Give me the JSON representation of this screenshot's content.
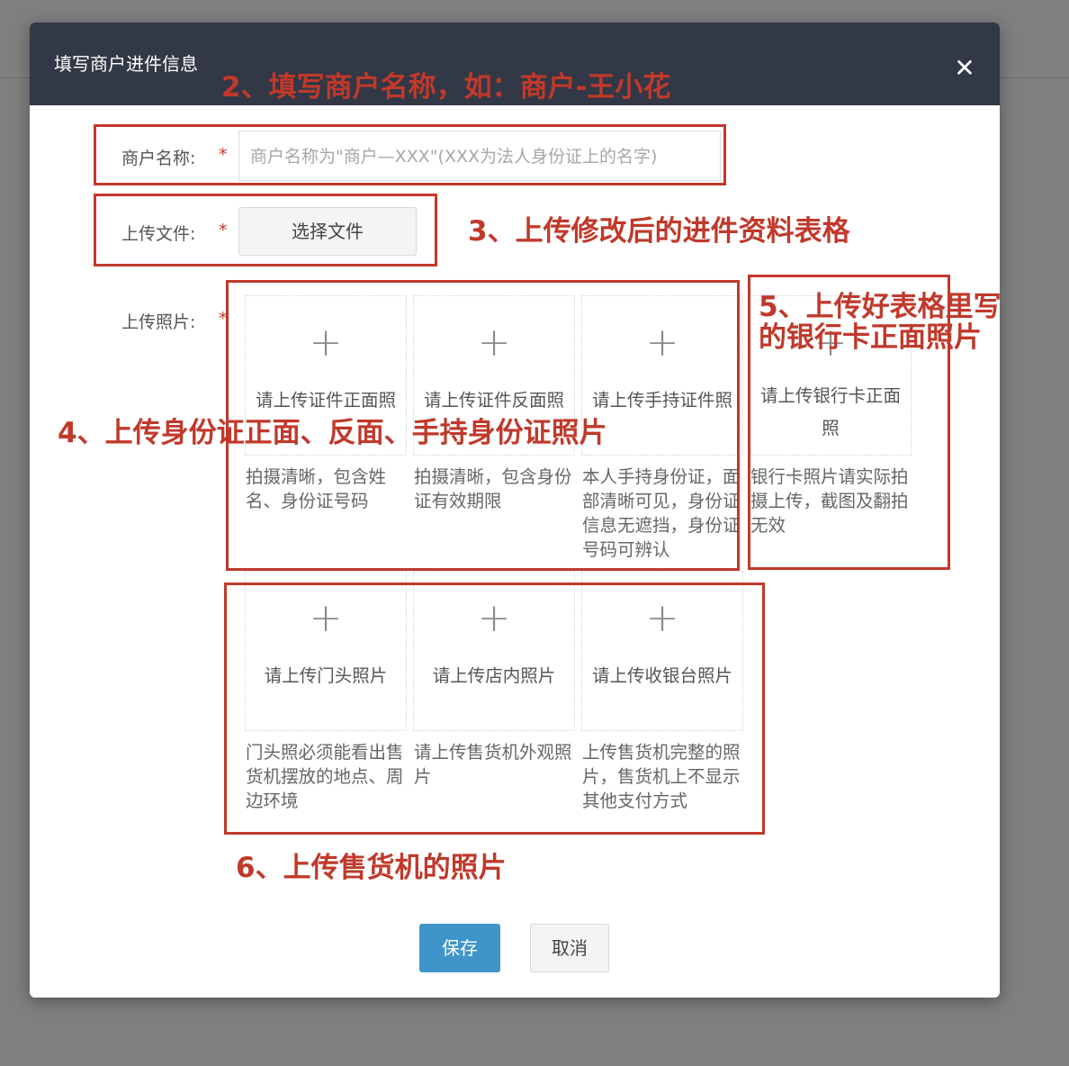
{
  "modal": {
    "title": "填写商户进件信息",
    "close_icon": "close-icon",
    "close_glyph": "✕"
  },
  "form": {
    "merchant_name_label": "商户名称:",
    "required_mark": "*",
    "merchant_name_placeholder": "商户名称为\"商户—XXX\"(XXX为法人身份证上的名字)",
    "upload_file_label": "上传文件:",
    "choose_file_button": "选择文件",
    "upload_photo_label": "上传照片:"
  },
  "photo_cards": [
    {
      "plus": "+",
      "label": "请上传证件正面照",
      "desc": "拍摄清晰，包含姓名、身份证号码"
    },
    {
      "plus": "+",
      "label": "请上传证件反面照",
      "desc": "拍摄清晰，包含身份证有效期限"
    },
    {
      "plus": "+",
      "label": "请上传手持证件照",
      "desc": "本人手持身份证，面部清晰可见，身份证信息无遮挡，身份证号码可辨认"
    },
    {
      "plus": "+",
      "label": "请上传银行卡正面照",
      "desc": "银行卡照片请实际拍摄上传，截图及翻拍无效"
    },
    {
      "plus": "+",
      "label": "请上传门头照片",
      "desc": "门头照必须能看出售货机摆放的地点、周边环境"
    },
    {
      "plus": "+",
      "label": "请上传店内照片",
      "desc": "请上传售货机外观照片"
    },
    {
      "plus": "+",
      "label": "请上传收银台照片",
      "desc": "上传售货机完整的照片，售货机上不显示其他支付方式"
    }
  ],
  "buttons": {
    "save": "保存",
    "cancel": "取消"
  },
  "annotations": {
    "color": "#c0392b",
    "step2": "2、填写商户名称，如：商户-王小花",
    "step3": "3、上传修改后的进件资料表格",
    "step4": "4、上传身份证正面、反面、手持身份证照片",
    "step5_line1": "5、上传好表格里写",
    "step5_line2": "的银行卡正面照片",
    "step6": "6、上传售货机的照片"
  },
  "colors": {
    "header_bg": "#323845",
    "primary": "#3f95c9",
    "required": "#c0392b"
  }
}
